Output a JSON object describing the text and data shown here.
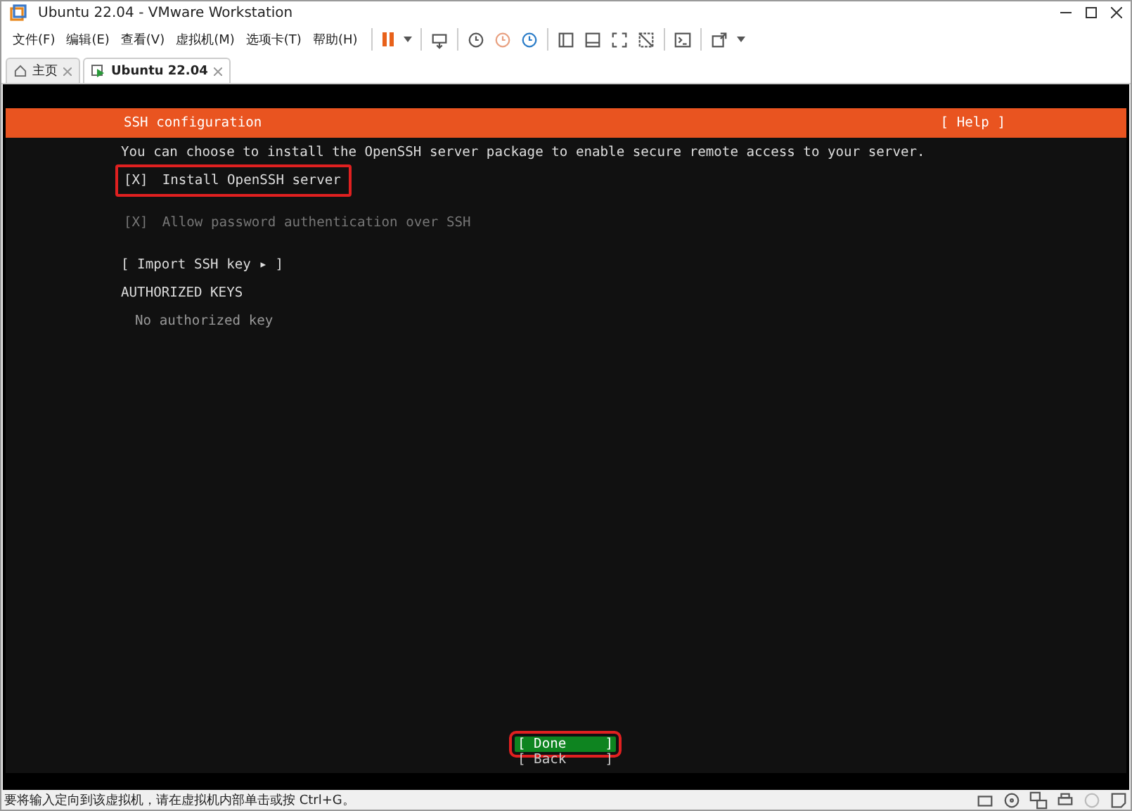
{
  "window": {
    "title": "Ubuntu 22.04 - VMware Workstation"
  },
  "menu": [
    "文件(F)",
    "编辑(E)",
    "查看(V)",
    "虚拟机(M)",
    "选项卡(T)",
    "帮助(H)"
  ],
  "tabs": [
    {
      "label": "主页",
      "kind": "home",
      "selected": false
    },
    {
      "label": "Ubuntu 22.04",
      "kind": "vm",
      "selected": true
    }
  ],
  "installer": {
    "title": "SSH configuration",
    "help": "[ Help ]",
    "description": "You can choose to install the OpenSSH server package to enable secure remote access to your server.",
    "options": [
      {
        "mark": "[X]",
        "label": "Install OpenSSH server",
        "checked": true,
        "disabled": false,
        "highlighted": true
      },
      {
        "mark": "[X]",
        "label": "Allow password authentication over SSH",
        "checked": true,
        "disabled": true,
        "highlighted": false
      }
    ],
    "import_button": "[ Import SSH key ▸ ]",
    "section": "AUTHORIZED KEYS",
    "empty_message": "No authorized key",
    "buttons": [
      {
        "open": "[",
        "label": "Done",
        "close": "]",
        "selected": true,
        "highlighted": true
      },
      {
        "open": "[",
        "label": "Back",
        "close": "]",
        "selected": false,
        "highlighted": false
      }
    ]
  },
  "status_bar": {
    "text": "要将输入定向到该虚拟机，请在虚拟机内部单击或按 Ctrl+G。"
  }
}
